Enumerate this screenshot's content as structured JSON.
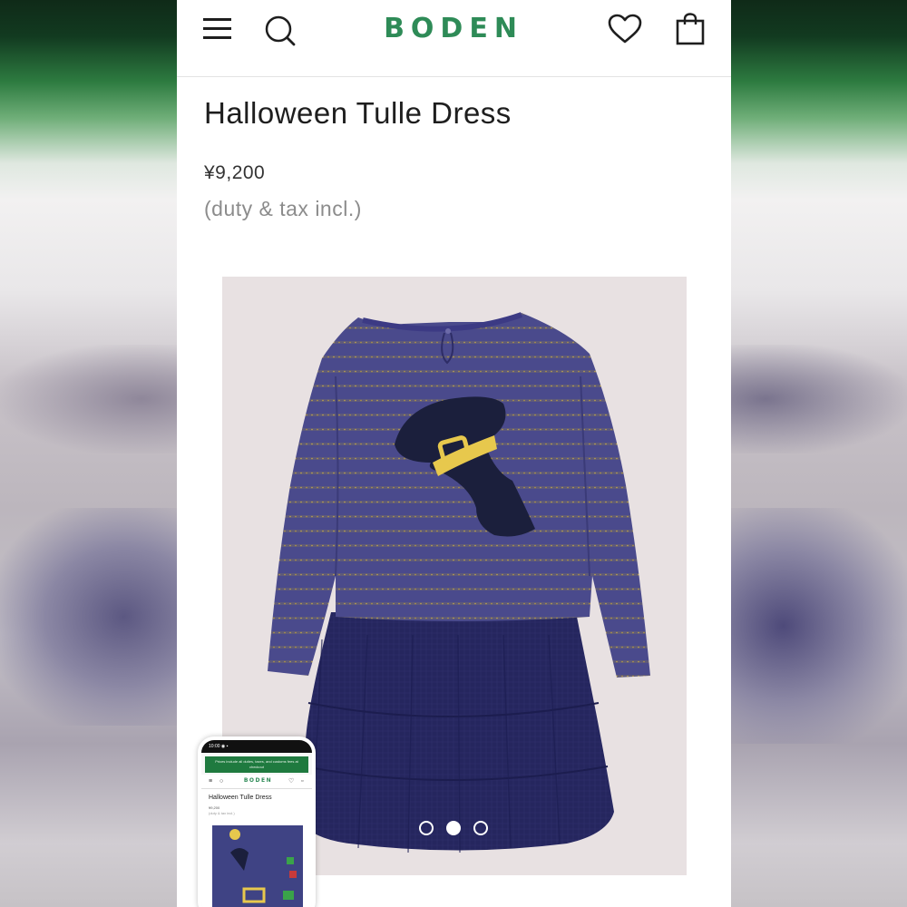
{
  "header": {
    "brand": "BODEN",
    "menu_icon": "hamburger-menu-icon",
    "search_icon": "search-icon",
    "wishlist_icon": "heart-icon",
    "bag_icon": "shopping-bag-icon",
    "brand_color": "#2e8b57"
  },
  "product": {
    "title": "Halloween Tulle Dress",
    "price": "¥9,200",
    "tax_note": "(duty & tax incl.)",
    "image_alt": "Halloween Tulle Dress back view",
    "carousel": {
      "total": 3,
      "active": 2
    }
  },
  "mini_preview": {
    "status": "10:00 ◉ ▪",
    "banner": "Prices include all duties, taxes, and customs fees at checkout",
    "brand": "BODEN",
    "title": "Halloween Tulle Dress",
    "price": "¥9,200",
    "tax_note": "(duty & tax incl.)"
  }
}
